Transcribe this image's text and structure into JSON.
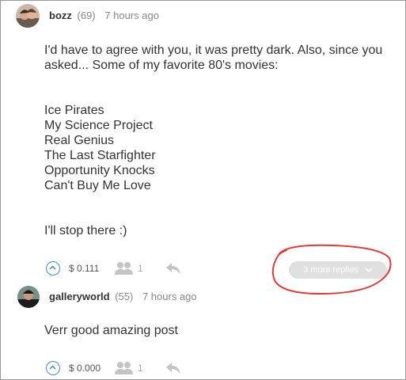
{
  "comments": [
    {
      "user": "bozz",
      "reputation": "(69)",
      "time": "7 hours ago",
      "body_lines": [
        "I'd have to agree with you, it was pretty dark.  Also, since you",
        "asked...  Some of my favorite 80's movies:",
        "",
        "",
        "Ice Pirates",
        "My Science Project",
        "Real Genius",
        "The Last Starfighter",
        "Opportunity Knocks",
        "Can't Buy Me Love",
        "",
        "",
        "I'll stop there :)"
      ],
      "payout": "$ 0.111",
      "votes": "1",
      "more_replies": "3 more replies"
    },
    {
      "user": "galleryworld",
      "reputation": "(55)",
      "time": "7 hours ago",
      "body_lines": [
        "Verr good amazing  post"
      ],
      "payout": "$ 0.000",
      "votes": "1"
    }
  ],
  "icons": {
    "upvote": "chevron-up-circle-icon",
    "voters": "people-icon",
    "reply": "reply-arrow-icon",
    "expand": "chevron-down-icon"
  },
  "colors": {
    "upvote": "#4a8fb3",
    "annotation": "#e0393b",
    "more_replies_bg": "#e0e0e0"
  }
}
